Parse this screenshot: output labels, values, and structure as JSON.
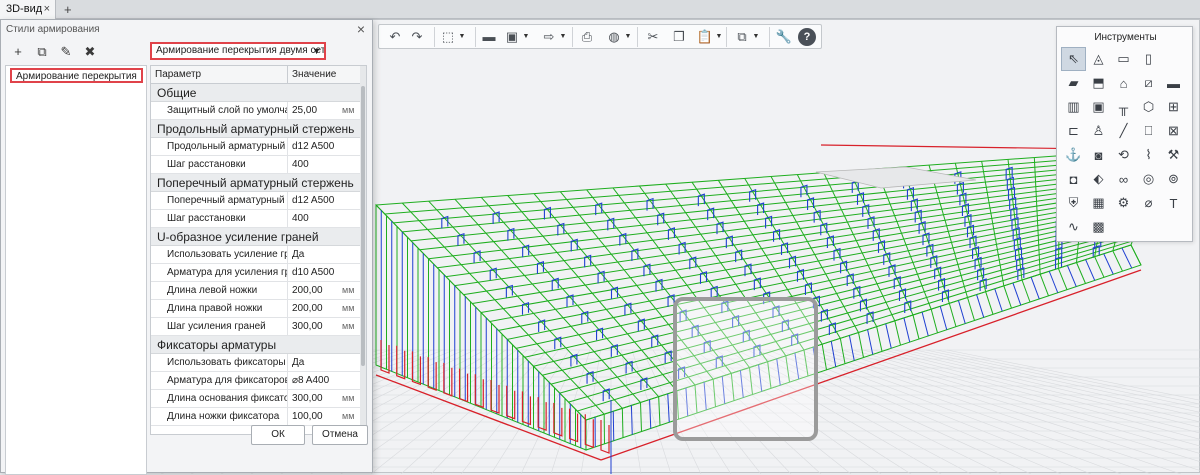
{
  "tabs": {
    "active_label": "3D-вид",
    "close_glyph": "×",
    "add_glyph": "+"
  },
  "dialog": {
    "title": "Стили армирования",
    "close_glyph": "×",
    "tool_icons": [
      "add-icon",
      "duplicate-icon",
      "edit-icon",
      "delete-icon"
    ],
    "tool_glyphs": [
      "+",
      "⧉",
      "✎",
      "✖"
    ],
    "style_list": [
      "Армирование перекрытия"
    ],
    "style_select": "Армирование перекрытия двумя сетками",
    "table_header": {
      "param": "Параметр",
      "value": "Значение"
    },
    "sections": [
      {
        "title": "Общие",
        "rows": [
          {
            "param": "Защитный слой по умолчанию",
            "value": "25,00",
            "unit": "мм"
          }
        ]
      },
      {
        "title": "Продольный арматурный стержень",
        "rows": [
          {
            "param": "Продольный арматурный сте...",
            "value": "d12 A500",
            "unit": ""
          },
          {
            "param": "Шаг расстановки",
            "value": "400",
            "unit": ""
          }
        ]
      },
      {
        "title": "Поперечный арматурный стержень",
        "rows": [
          {
            "param": "Поперечный арматурный сте...",
            "value": "d12 A500",
            "unit": ""
          },
          {
            "param": "Шаг расстановки",
            "value": "400",
            "unit": ""
          }
        ]
      },
      {
        "title": "U-образное усиление граней",
        "rows": [
          {
            "param": "Использовать усиление граней",
            "value": "Да",
            "unit": ""
          },
          {
            "param": "Арматура для усиления граней",
            "value": "d10 A500",
            "unit": ""
          },
          {
            "param": "Длина левой ножки",
            "value": "200,00",
            "unit": "мм"
          },
          {
            "param": "Длина правой ножки",
            "value": "200,00",
            "unit": "мм"
          },
          {
            "param": "Шаг усиления граней",
            "value": "300,00",
            "unit": "мм"
          }
        ]
      },
      {
        "title": "Фиксаторы арматуры",
        "rows": [
          {
            "param": "Использовать фиксаторы арм...",
            "value": "Да",
            "unit": ""
          },
          {
            "param": "Арматура для фиксаторов",
            "value": "⌀8 A400",
            "unit": ""
          },
          {
            "param": "Длина основания фиксатора",
            "value": "300,00",
            "unit": "мм"
          },
          {
            "param": "Длина ножки фиксатора",
            "value": "100,00",
            "unit": "мм"
          }
        ]
      }
    ],
    "ok_label": "ОК",
    "cancel_label": "Отмена"
  },
  "toolbar": {
    "icons": [
      "undo-icon",
      "redo-icon",
      "3d-view-icon",
      "open-folder-icon",
      "save-icon",
      "export-icon",
      "print-icon",
      "globe-icon",
      "cut-icon",
      "copy-icon",
      "paste-icon",
      "layers-icon",
      "wrench-icon",
      "help-icon"
    ]
  },
  "palette": {
    "title": "Инструменты",
    "items": [
      {
        "name": "select-tool-icon",
        "glyph": "⇖"
      },
      {
        "name": "shapes-tool-icon",
        "glyph": "◬"
      },
      {
        "name": "wall-tool-icon",
        "glyph": "▭"
      },
      {
        "name": "column-tool-icon",
        "glyph": "▯"
      },
      {
        "name": "blank",
        "glyph": ""
      },
      {
        "name": "slab-tool-icon",
        "glyph": "▰"
      },
      {
        "name": "slab-opening-tool-icon",
        "glyph": "⬒"
      },
      {
        "name": "roof-tool-icon",
        "glyph": "⌂"
      },
      {
        "name": "ramp-tool-icon",
        "glyph": "⧄"
      },
      {
        "name": "beam-tool-icon",
        "glyph": "▬"
      },
      {
        "name": "door-tool-icon",
        "glyph": "▥"
      },
      {
        "name": "window-tool-icon",
        "glyph": "▣"
      },
      {
        "name": "railing-tool-icon",
        "glyph": "╥"
      },
      {
        "name": "stair-tool-icon",
        "glyph": "⬡"
      },
      {
        "name": "frame-tool-icon",
        "glyph": "⊞"
      },
      {
        "name": "pipe-tool-icon",
        "glyph": "⊏"
      },
      {
        "name": "figure-tool-icon",
        "glyph": "♙"
      },
      {
        "name": "line-tool-icon",
        "glyph": "╱"
      },
      {
        "name": "rebar-tool-icon",
        "glyph": "⎕"
      },
      {
        "name": "mesh-tool-icon",
        "glyph": "⊠"
      },
      {
        "name": "anchor-tool-icon",
        "glyph": "⚓"
      },
      {
        "name": "rebar-set-tool-icon",
        "glyph": "◙"
      },
      {
        "name": "rebar-bend-tool-icon",
        "glyph": "⟲"
      },
      {
        "name": "rebar-clip-tool-icon",
        "glyph": "⌇"
      },
      {
        "name": "rebar-edge-tool-icon",
        "glyph": "⚒"
      },
      {
        "name": "mesh-area-tool-icon",
        "glyph": "◘"
      },
      {
        "name": "rebar-path-tool-icon",
        "glyph": "⬖"
      },
      {
        "name": "rebar-loop-tool-icon",
        "glyph": "∞"
      },
      {
        "name": "rebar-coil-tool-icon",
        "glyph": "◎"
      },
      {
        "name": "rebar-spiral-tool-icon",
        "glyph": "⊚"
      },
      {
        "name": "shield-tool-icon",
        "glyph": "⛨"
      },
      {
        "name": "fixture-tool-icon",
        "glyph": "▦"
      },
      {
        "name": "bundle-tool-icon",
        "glyph": "⚙"
      },
      {
        "name": "diameter-tool-icon",
        "glyph": "⌀"
      },
      {
        "name": "text-tool-icon",
        "glyph": "T"
      },
      {
        "name": "curve-tool-icon",
        "glyph": "∿"
      },
      {
        "name": "hatch-tool-icon",
        "glyph": "▩"
      }
    ]
  },
  "colors": {
    "accent_red": "#e0434a",
    "rebar_green": "#1fae1f",
    "rebar_blue": "#1f3fd1",
    "rebar_red": "#d8212a"
  }
}
